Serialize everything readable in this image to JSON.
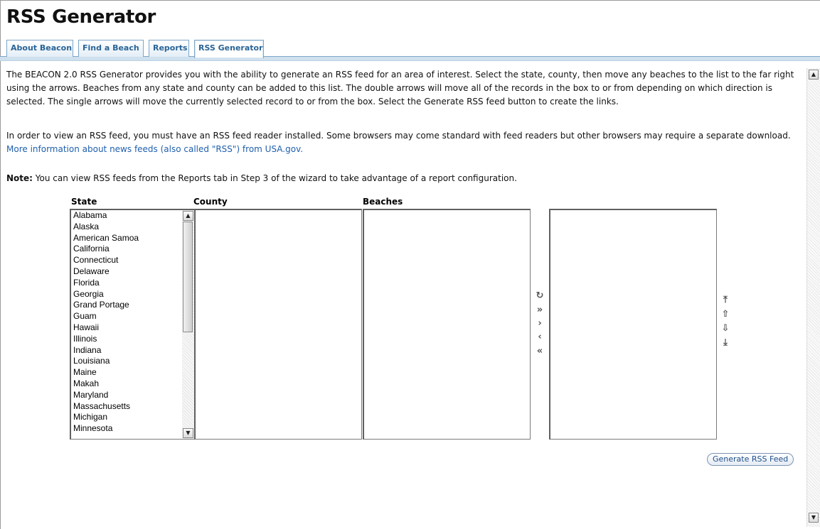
{
  "page": {
    "title": "RSS Generator"
  },
  "tabs": [
    {
      "label": "About Beacon",
      "active": false
    },
    {
      "label": "Find a Beach",
      "active": false
    },
    {
      "label": "Reports",
      "active": false
    },
    {
      "label": "RSS Generator",
      "active": true
    }
  ],
  "intro": {
    "p1": "The BEACON 2.0 RSS Generator provides you with the ability to generate an RSS feed for an area of interest. Select the state, county, then move any beaches to the list to the far right using the arrows. Beaches from any state and county can be added to this list. The double arrows will move all of the records in the box to or from depending on which direction is selected. The single arrows will move the currently selected record to or from the box. Select the Generate RSS feed button to create the links.",
    "p2_text": "In order to view an RSS feed, you must have an RSS feed reader installed. Some browsers may come standard with feed readers but other browsers may require a separate download.",
    "p2_link": "More information about news feeds (also called \"RSS\") from USA.gov.",
    "note_label": "Note:",
    "note_text": "You can view RSS feeds from the Reports tab in Step 3 of the wizard to take advantage of a report configuration."
  },
  "labels": {
    "state": "State",
    "county": "County",
    "beaches": "Beaches"
  },
  "states": [
    "Alabama",
    "Alaska",
    "American Samoa",
    "California",
    "Connecticut",
    "Delaware",
    "Florida",
    "Georgia",
    "Grand Portage",
    "Guam",
    "Hawaii",
    "Illinois",
    "Indiana",
    "Louisiana",
    "Maine",
    "Makah",
    "Maryland",
    "Massachusetts",
    "Michigan",
    "Minnesota"
  ],
  "icons": {
    "refresh": "refresh-icon",
    "move_all_right": "double-chevron-right-icon",
    "move_right": "chevron-right-icon",
    "move_left": "chevron-left-icon",
    "move_all_left": "double-chevron-left-icon",
    "move_top": "move-to-top-icon",
    "move_up": "move-up-icon",
    "move_down": "move-down-icon",
    "move_bottom": "move-to-bottom-icon"
  },
  "buttons": {
    "generate": "Generate RSS Feed"
  }
}
